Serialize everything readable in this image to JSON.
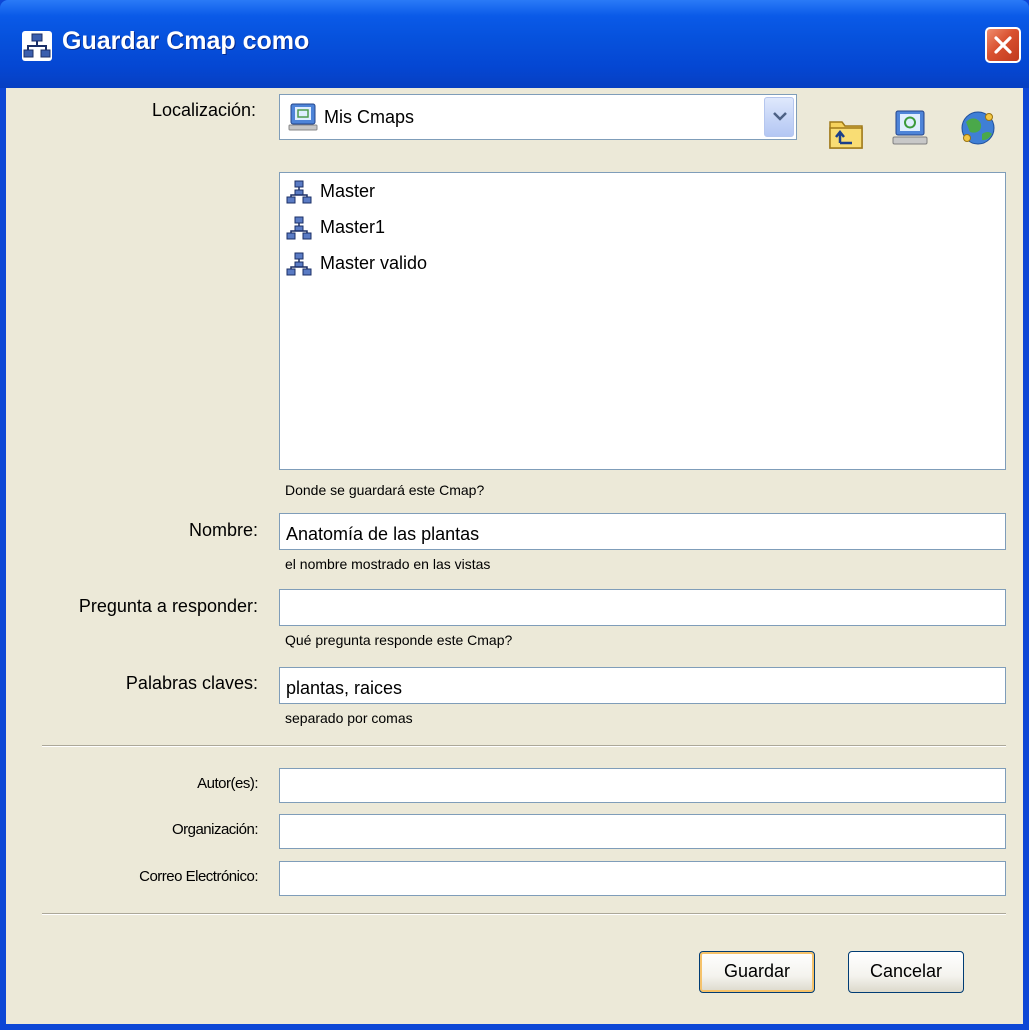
{
  "window": {
    "title": "Guardar Cmap como",
    "title_icon": "cmap-icon",
    "close_icon": "close-icon"
  },
  "location": {
    "label": "Localización:",
    "selected": "Mis Cmaps",
    "icons": [
      "folder-up-icon",
      "my-cmaps-icon",
      "network-places-icon"
    ]
  },
  "file_list": {
    "items": [
      {
        "label": "Master",
        "icon": "cmap-icon"
      },
      {
        "label": "Master1",
        "icon": "cmap-icon"
      },
      {
        "label": "Master valido",
        "icon": "cmap-icon"
      }
    ],
    "hint": "Donde se guardará este Cmap?"
  },
  "form": {
    "name_label": "Nombre:",
    "name_value": "Anatomía de las plantas",
    "name_hint": "el nombre mostrado en las vistas",
    "question_label": "Pregunta a responder:",
    "question_value": "",
    "question_hint": "Qué pregunta responde este Cmap?",
    "keywords_label": "Palabras claves:",
    "keywords_value": "plantas, raices",
    "keywords_hint": "separado por comas",
    "author_label": "Autor(es):",
    "author_value": "",
    "org_label": "Organización:",
    "org_value": "",
    "email_label": "Correo Electrónico:",
    "email_value": ""
  },
  "buttons": {
    "save": "Guardar",
    "cancel": "Cancelar"
  },
  "colors": {
    "title_bar": "#0551dc",
    "dialog_bg": "#ece9d8",
    "field_border": "#7f9db9",
    "close_button": "#d9512f"
  }
}
